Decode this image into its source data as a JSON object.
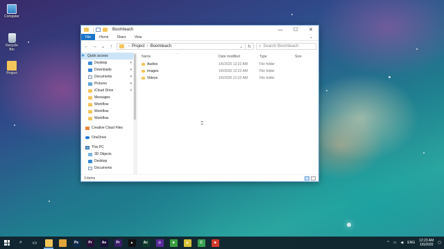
{
  "desktop": {
    "icons": [
      {
        "label": "Computer",
        "icon": "computer-icon"
      },
      {
        "label": "Recycle Bin",
        "icon": "recycle-bin-icon"
      },
      {
        "label": "Project",
        "icon": "folder-icon"
      }
    ]
  },
  "window": {
    "title": "Boomteach",
    "controls": {
      "minimize": "—",
      "maximize": "☐",
      "close": "✕"
    },
    "ribbon_tabs": [
      {
        "label": "File"
      },
      {
        "label": "Home"
      },
      {
        "label": "Share"
      },
      {
        "label": "View"
      }
    ],
    "address": {
      "back": "←",
      "forward": "→",
      "recent": "⌄",
      "up": "↑",
      "segments": [
        "Project",
        "Boomteach"
      ],
      "separator": "›",
      "refresh": "↻"
    },
    "search": {
      "placeholder": "Search Boomteach"
    },
    "nav_pane": {
      "items": [
        {
          "label": "Quick access",
          "icon": "star-icon",
          "pinned": false
        },
        {
          "label": "Desktop",
          "icon": "desktop-icon",
          "pinned": true
        },
        {
          "label": "Downloads",
          "icon": "downloads-icon",
          "pinned": true
        },
        {
          "label": "Documents",
          "icon": "documents-icon",
          "pinned": true
        },
        {
          "label": "Pictures",
          "icon": "pictures-icon",
          "pinned": true
        },
        {
          "label": "iCloud Drive",
          "icon": "folder-icon",
          "pinned": true
        },
        {
          "label": "Messages",
          "icon": "folder-icon",
          "pinned": false
        },
        {
          "label": "Workflow",
          "icon": "folder-icon",
          "pinned": false
        },
        {
          "label": "Workflow",
          "icon": "folder-icon",
          "pinned": false
        },
        {
          "label": "Workflow",
          "icon": "folder-icon",
          "pinned": false
        },
        {
          "label": "Creative Cloud Files",
          "icon": "creative-cloud-icon",
          "pinned": false
        },
        {
          "label": "OneDrive",
          "icon": "onedrive-icon",
          "pinned": false
        },
        {
          "label": "This PC",
          "icon": "this-pc-icon",
          "pinned": false
        },
        {
          "label": "3D Objects",
          "icon": "3d-objects-icon",
          "pinned": false
        },
        {
          "label": "Desktop",
          "icon": "desktop-icon",
          "pinned": false
        },
        {
          "label": "Documents",
          "icon": "documents-icon",
          "pinned": false
        }
      ],
      "pin_glyph": "📌"
    },
    "columns": {
      "name": "Name",
      "date": "Date modified",
      "type": "Type",
      "size": "Size"
    },
    "files": [
      {
        "name": "Audios",
        "date": "1/6/2020 12:22 AM",
        "type": "File folder",
        "size": ""
      },
      {
        "name": "Images",
        "date": "1/6/2020 12:22 AM",
        "type": "File folder",
        "size": ""
      },
      {
        "name": "Videos",
        "date": "1/6/2020 12:22 AM",
        "type": "File folder",
        "size": ""
      }
    ],
    "status": "3 items"
  },
  "taskbar": {
    "apps": [
      {
        "name": "search",
        "glyph": "⌕",
        "color": ""
      },
      {
        "name": "task-view",
        "glyph": "▭",
        "color": ""
      },
      {
        "name": "file-explorer",
        "glyph": "",
        "color": "#f2c65a",
        "active": true
      },
      {
        "name": "chrome",
        "glyph": "",
        "color": "#e0a43a"
      },
      {
        "name": "photoshop",
        "glyph": "Ps",
        "color": "#0f2a4a"
      },
      {
        "name": "premiere",
        "glyph": "Pr",
        "color": "#2a0f3a"
      },
      {
        "name": "after-effects",
        "glyph": "Ae",
        "color": "#1a0f3a"
      },
      {
        "name": "premiere-alt",
        "glyph": "Pr",
        "color": "#3a1f6a"
      },
      {
        "name": "app-dark",
        "glyph": "▲",
        "color": "#111"
      },
      {
        "name": "acrobat-like",
        "glyph": "Ac",
        "color": "#0f3a2a"
      },
      {
        "name": "visual-studio",
        "glyph": "◇",
        "color": "#5a2a9a"
      },
      {
        "name": "app-green",
        "glyph": "■",
        "color": "#3aa040"
      },
      {
        "name": "app-yellow",
        "glyph": "▲",
        "color": "#d8c23a"
      },
      {
        "name": "camtasia",
        "glyph": "C",
        "color": "#3aa050"
      },
      {
        "name": "app-red",
        "glyph": "■",
        "color": "#d03a2a"
      }
    ],
    "tray": {
      "chevron": "^",
      "lang": "ENG",
      "time": "12:23 AM",
      "date": "1/6/2020"
    }
  }
}
